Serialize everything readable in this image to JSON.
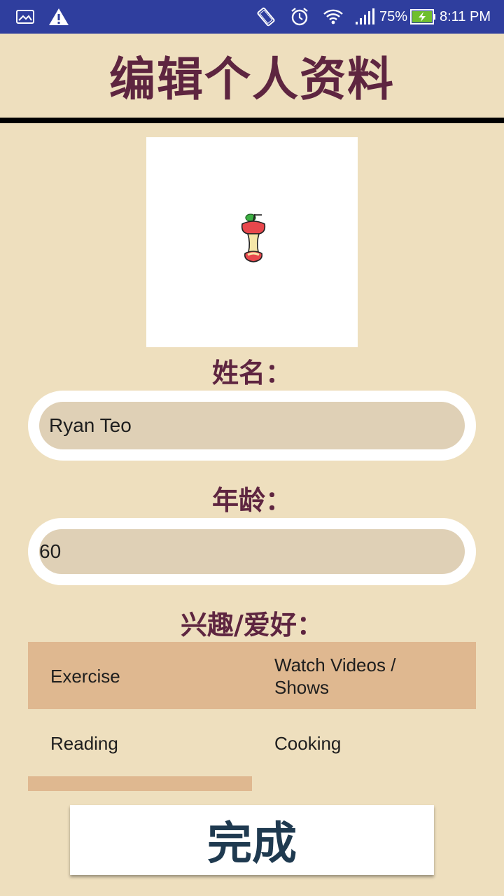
{
  "status_bar": {
    "battery_percent": "75%",
    "time": "8:11 PM",
    "icons": [
      "image-icon",
      "warning-icon",
      "rotate-icon",
      "alarm-icon",
      "wifi-icon",
      "signal-icon",
      "battery-charging-icon"
    ]
  },
  "header": {
    "title": "编辑个人资料"
  },
  "profile": {
    "photo_icon": "apple-core-icon"
  },
  "name_field": {
    "label": "姓名：",
    "value": "Ryan Teo"
  },
  "age_field": {
    "label": "年龄：",
    "value": "60"
  },
  "interests": {
    "label": "兴趣/爱好：",
    "items": [
      {
        "text": "Exercise",
        "selected": true
      },
      {
        "text": "Watch Videos / Shows",
        "selected": true
      },
      {
        "text": "Reading",
        "selected": false
      },
      {
        "text": "Cooking",
        "selected": false
      }
    ],
    "selected_color": "#DFB890"
  },
  "done_button": {
    "label": "完成"
  },
  "colors": {
    "background": "#EEDFBE",
    "status_bar": "#2F3E9E",
    "title_text": "#5E2540",
    "button_text": "#1F3A50"
  }
}
